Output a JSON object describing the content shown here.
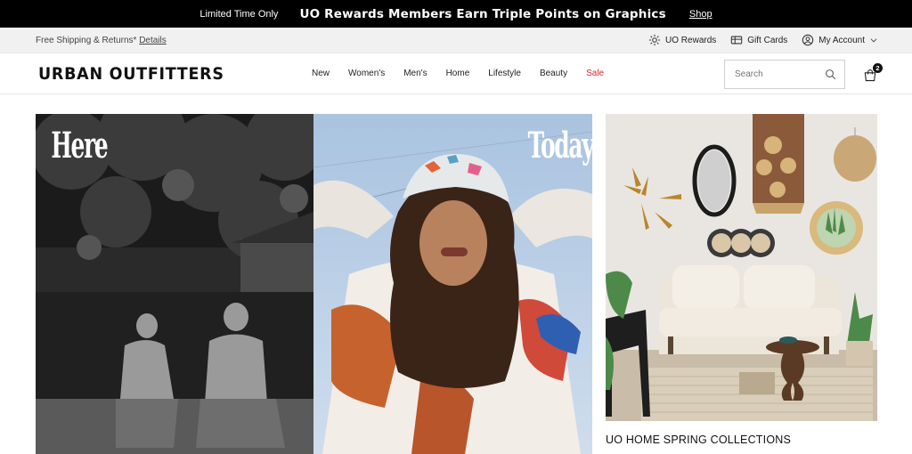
{
  "promo": {
    "small": "Limited Time Only",
    "headline": "UO Rewards Members Earn Triple Points on Graphics",
    "link": "Shop"
  },
  "utility": {
    "shipping_text": "Free Shipping & Returns*",
    "details_link": "Details",
    "items": [
      {
        "label": "UO Rewards",
        "icon": "rewards-icon"
      },
      {
        "label": "Gift Cards",
        "icon": "gift-card-icon"
      },
      {
        "label": "My Account",
        "icon": "account-icon"
      }
    ]
  },
  "header": {
    "logo": "URBAN OUTFITTERS",
    "nav": [
      "New",
      "Women's",
      "Men's",
      "Home",
      "Lifestyle",
      "Beauty",
      "Sale"
    ],
    "search_placeholder": "Search",
    "cart_count": "2",
    "sale_color": "#e0242a"
  },
  "hero": {
    "left_word": "Here",
    "right_word": "Today"
  },
  "home": {
    "caption": "UO HOME SPRING COLLECTIONS"
  }
}
